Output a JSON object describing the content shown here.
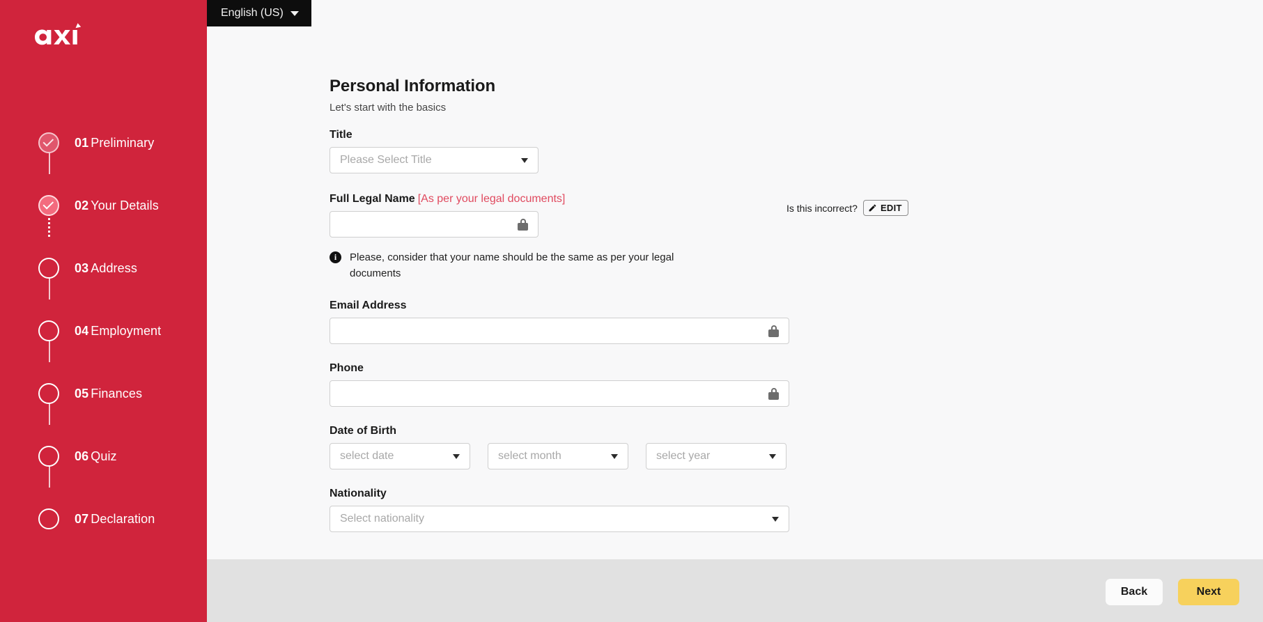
{
  "brand": {
    "logo_text": "axi",
    "sidebar_color": "#d0243c",
    "accent_red": "#e04a5f",
    "next_button_color": "#f7d15c"
  },
  "language_selector": {
    "label": "English (US)",
    "caret_icon": "chevron-down-icon"
  },
  "sidebar": {
    "steps": [
      {
        "num": "01",
        "label": "Preliminary",
        "state": "completed-faded"
      },
      {
        "num": "02",
        "label": "Your Details",
        "state": "completed"
      },
      {
        "num": "03",
        "label": "Address",
        "state": "pending"
      },
      {
        "num": "04",
        "label": "Employment",
        "state": "pending"
      },
      {
        "num": "05",
        "label": "Finances",
        "state": "pending"
      },
      {
        "num": "06",
        "label": "Quiz",
        "state": "pending"
      },
      {
        "num": "07",
        "label": "Declaration",
        "state": "pending"
      }
    ]
  },
  "form": {
    "title": "Personal Information",
    "subtitle": "Let's start with the basics",
    "title_field": {
      "label": "Title",
      "placeholder": "Please Select Title",
      "value": ""
    },
    "full_legal_name": {
      "label": "Full Legal Name",
      "hint": "[As per your legal documents]",
      "value": "",
      "placeholder": "",
      "locked": true,
      "incorrect_prompt": "Is this incorrect?",
      "edit_label": "EDIT",
      "edit_icon": "pencil-icon"
    },
    "name_notice": "Please, consider that your name should be the same as per your legal documents",
    "email": {
      "label": "Email Address",
      "value": "",
      "placeholder": "",
      "locked": true
    },
    "phone": {
      "label": "Phone",
      "value": "",
      "placeholder": "",
      "locked": true
    },
    "date_of_birth": {
      "label": "Date of Birth",
      "day_placeholder": "select date",
      "month_placeholder": "select month",
      "year_placeholder": "select year"
    },
    "nationality": {
      "label": "Nationality",
      "placeholder": "Select nationality",
      "value": ""
    }
  },
  "footer": {
    "back_label": "Back",
    "next_label": "Next"
  }
}
